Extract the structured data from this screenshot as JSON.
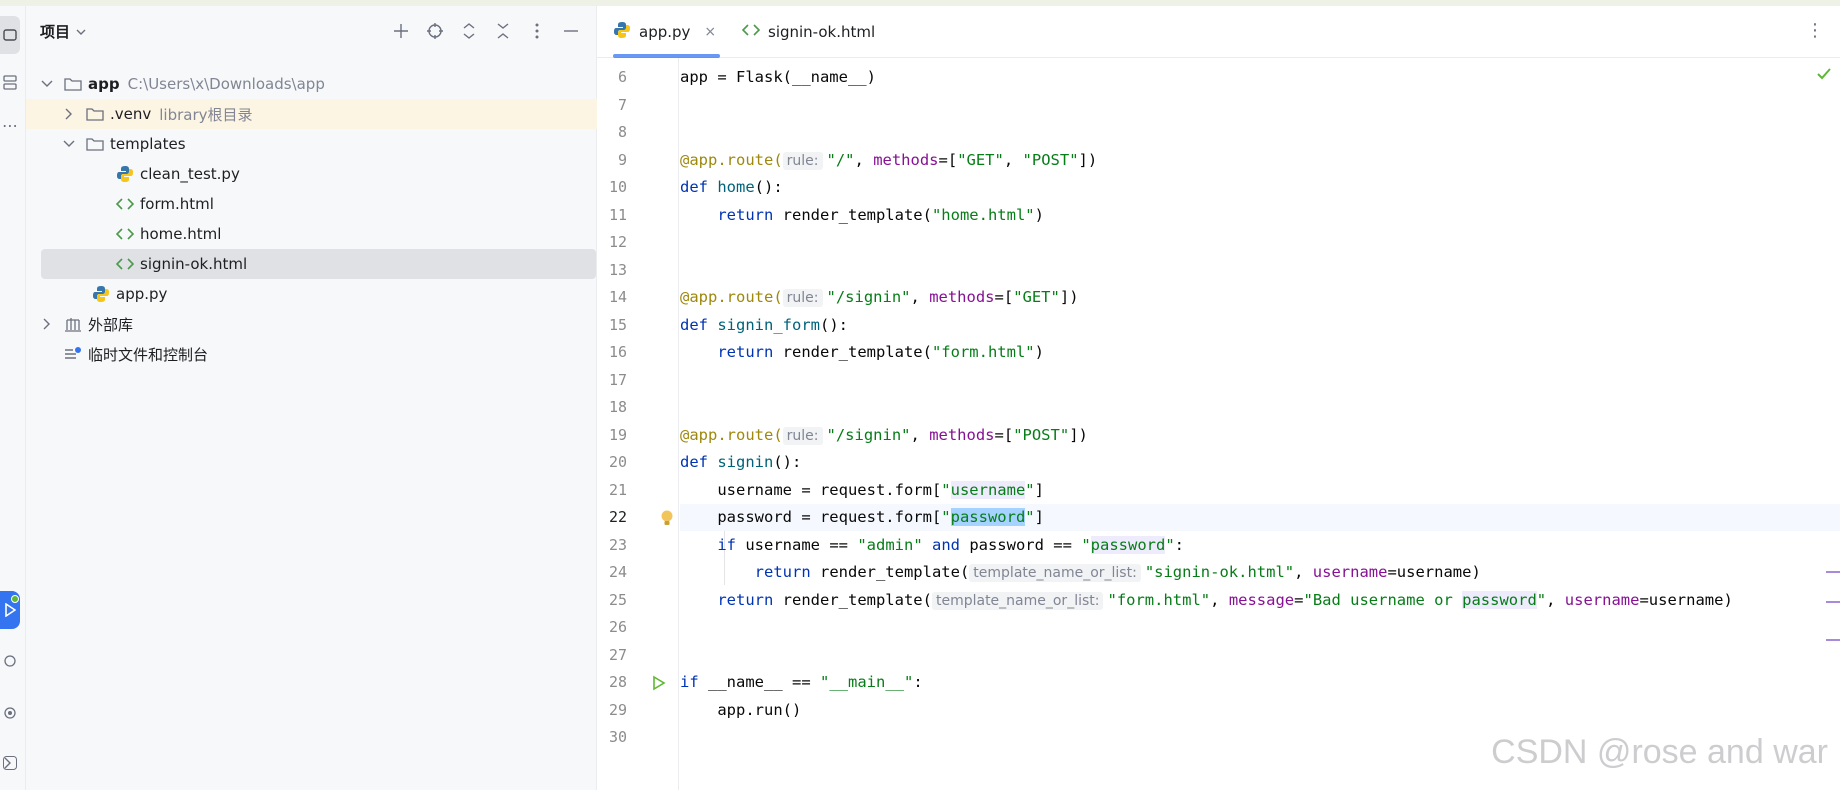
{
  "project_panel": {
    "title": "项目",
    "header_icons": [
      "add-icon",
      "locate-icon",
      "expand-all-icon",
      "collapse-all-icon",
      "more-icon",
      "minimize-icon"
    ],
    "tree": [
      {
        "label": "app",
        "hint": "C:\\Users\\x\\Downloads\\app",
        "type": "folder",
        "expanded": true
      },
      {
        "label": ".venv",
        "hint": "library根目录",
        "type": "folder",
        "expanded": false
      },
      {
        "label": "templates",
        "type": "folder",
        "expanded": true
      },
      {
        "label": "clean_test.py",
        "type": "python"
      },
      {
        "label": "form.html",
        "type": "html"
      },
      {
        "label": "home.html",
        "type": "html"
      },
      {
        "label": "signin-ok.html",
        "type": "html",
        "selected": true
      },
      {
        "label": "app.py",
        "type": "python"
      },
      {
        "label": "外部库",
        "type": "library",
        "expanded": false
      },
      {
        "label": "临时文件和控制台",
        "type": "scratches"
      }
    ]
  },
  "editor": {
    "tabs": [
      {
        "label": "app.py",
        "active": true,
        "close": "×"
      },
      {
        "label": "signin-ok.html",
        "active": false
      }
    ],
    "more": "⋮",
    "lines": {
      "n6": "6",
      "n7": "7",
      "n8": "8",
      "n9": "9",
      "n10": "10",
      "n11": "11",
      "n12": "12",
      "n13": "13",
      "n14": "14",
      "n15": "15",
      "n16": "16",
      "n17": "17",
      "n18": "18",
      "n19": "19",
      "n20": "20",
      "n21": "21",
      "n22": "22",
      "n23": "23",
      "n24": "24",
      "n25": "25",
      "n26": "26",
      "n27": "27",
      "n28": "28",
      "n29": "29",
      "n30": "30"
    },
    "code": {
      "l6": "app = Flask(__name__)",
      "rule_hint": "rule:",
      "tpl_hint": "template_name_or_list:",
      "l9_dec": "@app.route(",
      "l9_a": "\"/\"",
      "l9_b": ", ",
      "l9_methods": "methods",
      "l9_c": "=[",
      "l9_get": "\"GET\"",
      "l9_d": ", ",
      "l9_post": "\"POST\"",
      "l9_e": "])",
      "l10_def": "def",
      "l10_name": "home",
      "l10_rest": "():",
      "l11_ret": "return",
      "l11_call": " render_template(",
      "l11_str": "\"home.html\"",
      "l11_end": ")",
      "l14_dec": "@app.route(",
      "l14_a": "\"/signin\"",
      "l14_b": ", ",
      "l14_methods": "methods",
      "l14_c": "=[",
      "l14_get": "\"GET\"",
      "l14_e": "])",
      "l15_def": "def",
      "l15_name": "signin_form",
      "l15_rest": "():",
      "l16_ret": "return",
      "l16_call": " render_template(",
      "l16_str": "\"form.html\"",
      "l16_end": ")",
      "l19_dec": "@app.route(",
      "l19_a": "\"/signin\"",
      "l19_b": ", ",
      "l19_methods": "methods",
      "l19_c": "=[",
      "l19_post": "\"POST\"",
      "l19_e": "])",
      "l20_def": "def",
      "l20_name": "signin",
      "l20_rest": "():",
      "l21_a": "username = request.form[",
      "l21_q1": "\"",
      "l21_key": "username",
      "l21_q2": "\"",
      "l21_end": "]",
      "l22_a": "password = request.form[",
      "l22_q1": "\"",
      "l22_key": "password",
      "l22_q2": "\"",
      "l22_end": "]",
      "l23_if": "if",
      "l23_a": " username == ",
      "l23_admin": "\"admin\"",
      "l23_and": " and",
      "l23_b": " password == ",
      "l23_q1": "\"",
      "l23_pw": "password",
      "l23_q2": "\"",
      "l23_end": ":",
      "l24_ret": "return",
      "l24_call": " render_template(",
      "l24_str": "\"signin-ok.html\"",
      "l24_b": ", ",
      "l24_param": "username",
      "l24_c": "=username)",
      "l25_ret": "return",
      "l25_call": " render_template(",
      "l25_str": "\"form.html\"",
      "l25_b": ", ",
      "l25_msg": "message",
      "l25_c": "=",
      "l25_s1": "\"Bad username or ",
      "l25_pw": "password",
      "l25_s2": "\"",
      "l25_d": ", ",
      "l25_param": "username",
      "l25_e": "=username)",
      "l28_if": "if",
      "l28_a": " __name__ == ",
      "l28_str": "\"__main__\"",
      "l28_end": ":",
      "l29": "app.run()"
    }
  },
  "watermark": "CSDN @rose and war"
}
